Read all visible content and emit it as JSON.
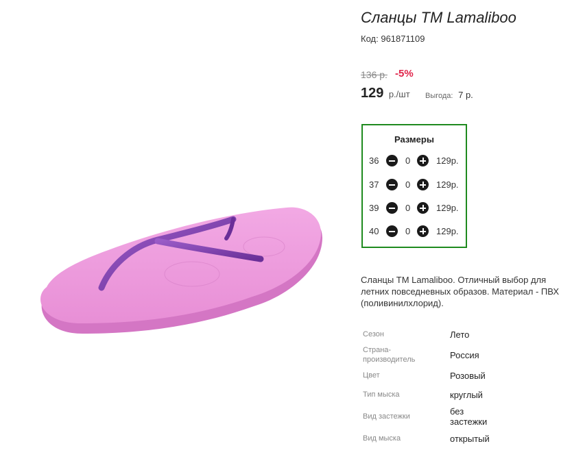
{
  "product": {
    "title": "Сланцы TM Lamaliboo",
    "code_label": "Код:",
    "code_value": "961871109"
  },
  "pricing": {
    "old_price": "136 р.",
    "discount": "-5%",
    "price": "129",
    "unit": "р./шт",
    "benefit_label": "Выгода:",
    "benefit_value": "7 р."
  },
  "sizes": {
    "title": "Размеры",
    "rows": [
      {
        "size": "36",
        "qty": "0",
        "price": "129р."
      },
      {
        "size": "37",
        "qty": "0",
        "price": "129р."
      },
      {
        "size": "39",
        "qty": "0",
        "price": "129р."
      },
      {
        "size": "40",
        "qty": "0",
        "price": "129р."
      }
    ]
  },
  "description": "Сланцы TM Lamaliboo. Отличный выбор для летних повседневных образов. Материал - ПВХ (поливинилхлорид).",
  "properties": [
    {
      "label": "Сезон",
      "value": "Лето"
    },
    {
      "label": "Страна-производитель",
      "value": "Россия"
    },
    {
      "label": "Цвет",
      "value": "Розовый"
    },
    {
      "label": "Тип мыска",
      "value": "круглый"
    },
    {
      "label": "Вид застежки",
      "value": "без застежки"
    },
    {
      "label": "Вид мыска",
      "value": "открытый"
    }
  ],
  "colors": {
    "sizes_border": "#1e8a1e",
    "discount": "#e0244a",
    "sole_pink": "#e88fd6",
    "strap_purple": "#7b3fa8"
  }
}
